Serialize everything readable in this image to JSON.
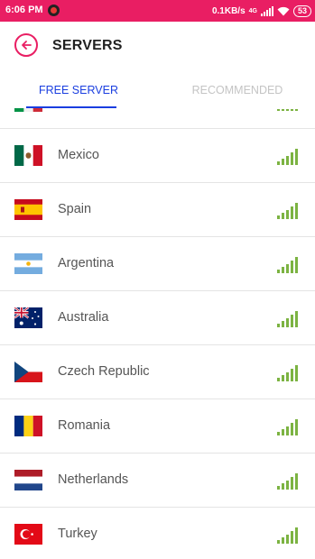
{
  "status_bar": {
    "time": "6:06 PM",
    "speed": "0.1KB/s",
    "network": "4G",
    "battery": "53"
  },
  "header": {
    "title": "SERVERS"
  },
  "tabs": [
    {
      "label": "FREE SERVER",
      "active": true
    },
    {
      "label": "RECOMMENDED",
      "active": false
    }
  ],
  "servers": [
    {
      "country": "",
      "flag": "italy",
      "signal_bars": 4
    },
    {
      "country": "Mexico",
      "flag": "mexico",
      "signal_bars": 5
    },
    {
      "country": "Spain",
      "flag": "spain",
      "signal_bars": 5
    },
    {
      "country": "Argentina",
      "flag": "argentina",
      "signal_bars": 5
    },
    {
      "country": "Australia",
      "flag": "australia",
      "signal_bars": 5
    },
    {
      "country": "Czech Republic",
      "flag": "czech-republic",
      "signal_bars": 5
    },
    {
      "country": "Romania",
      "flag": "romania",
      "signal_bars": 5
    },
    {
      "country": "Netherlands",
      "flag": "netherlands",
      "signal_bars": 5
    },
    {
      "country": "Turkey",
      "flag": "turkey",
      "signal_bars": 5
    }
  ],
  "colors": {
    "accent": "#e91e63",
    "tab_active": "#1a3ee0",
    "tab_inactive": "#c4c4c4",
    "signal": "#7cb342"
  }
}
